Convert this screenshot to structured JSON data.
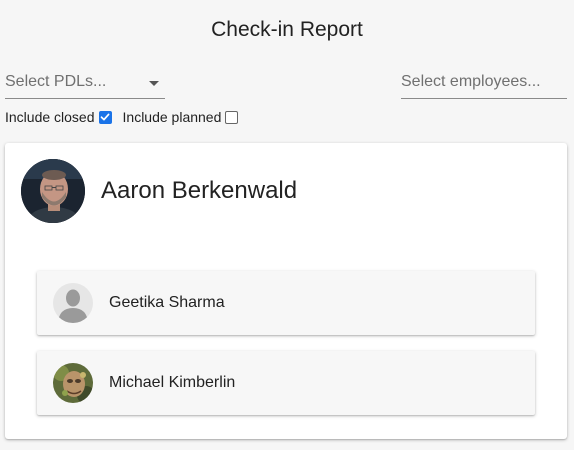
{
  "header": {
    "title": "Check-in Report"
  },
  "filters": {
    "pdl_placeholder": "Select PDLs...",
    "employees_placeholder": "Select employees...",
    "include_closed_label": "Include closed",
    "include_closed_checked": true,
    "include_planned_label": "Include planned",
    "include_planned_checked": false,
    "accent_color": "#1a73e8"
  },
  "pdl": {
    "name": "Aaron Berkenwald",
    "avatar_icon": "user-photo",
    "team": [
      {
        "name": "Geetika Sharma",
        "avatar_icon": "default-person-silhouette"
      },
      {
        "name": "Michael Kimberlin",
        "avatar_icon": "user-photo"
      }
    ]
  }
}
